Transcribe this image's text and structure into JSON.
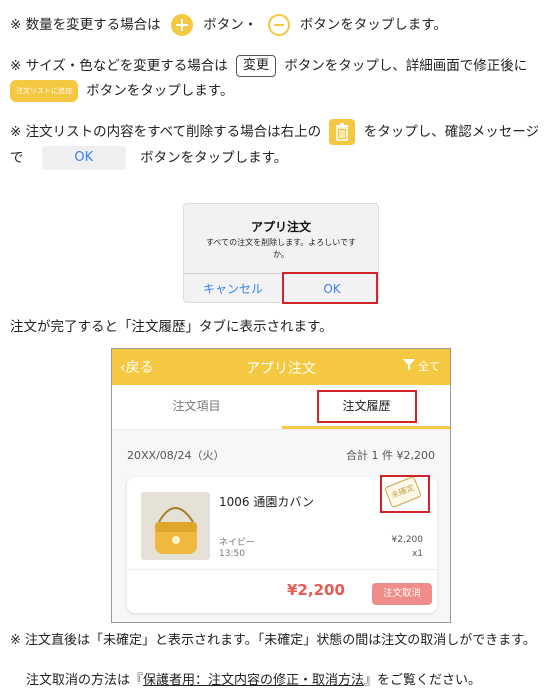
{
  "instr1": {
    "prefix": "※ 数量を変更する場合は",
    "mid": "ボタン・",
    "suffix": "ボタンをタップします。"
  },
  "instr2": {
    "prefix": "※ サイズ・色などを変更する場合は",
    "henko": "変更",
    "mid": "ボタンをタップし、詳細画面で修正後に",
    "addlist": "注文リストに追加",
    "suffix": "ボタンをタップします。"
  },
  "instr3": {
    "prefix": "※ 注文リストの内容をすべて削除する場合は右上の",
    "mid": "をタップし、確認メッセージ",
    "de": "で",
    "ok": "OK",
    "suffix": "ボタンをタップします。"
  },
  "dialog": {
    "title": "アプリ注文",
    "message": "すべての注文を削除します。よろしいですか。",
    "cancel": "キャンセル",
    "ok": "OK"
  },
  "completion": "注文が完了すると「注文履歴」タブに表示されます。",
  "app": {
    "back": "戻る",
    "title": "アプリ注文",
    "filter": "全て",
    "tabs": [
      "注文項目",
      "注文履歴"
    ],
    "date": "20XX/08/24（火）",
    "summary": "合計 1 件 ¥2,200",
    "item": {
      "name": "1006 通園カバン",
      "color": "ネイビー",
      "time": "13:50",
      "price": "¥2,200",
      "qty": "x1",
      "stamp": "未確定"
    },
    "total": "¥2,200",
    "cancel": "注文取消"
  },
  "note1": "※ 注文直後は「未確定」と表示されます。「未確定」状態の間は注文の取消しができます。",
  "note2": {
    "prefix": "注文取消の方法は『",
    "link": "保護者用：注文内容の修正・取消方法",
    "suffix": "』をご覧ください。"
  },
  "colors": {
    "accent": "#f5c842",
    "highlight": "#d2232a",
    "link_blue": "#3b82e6",
    "cancel_red": "#ee8d8a",
    "price_red": "#e85a55"
  }
}
